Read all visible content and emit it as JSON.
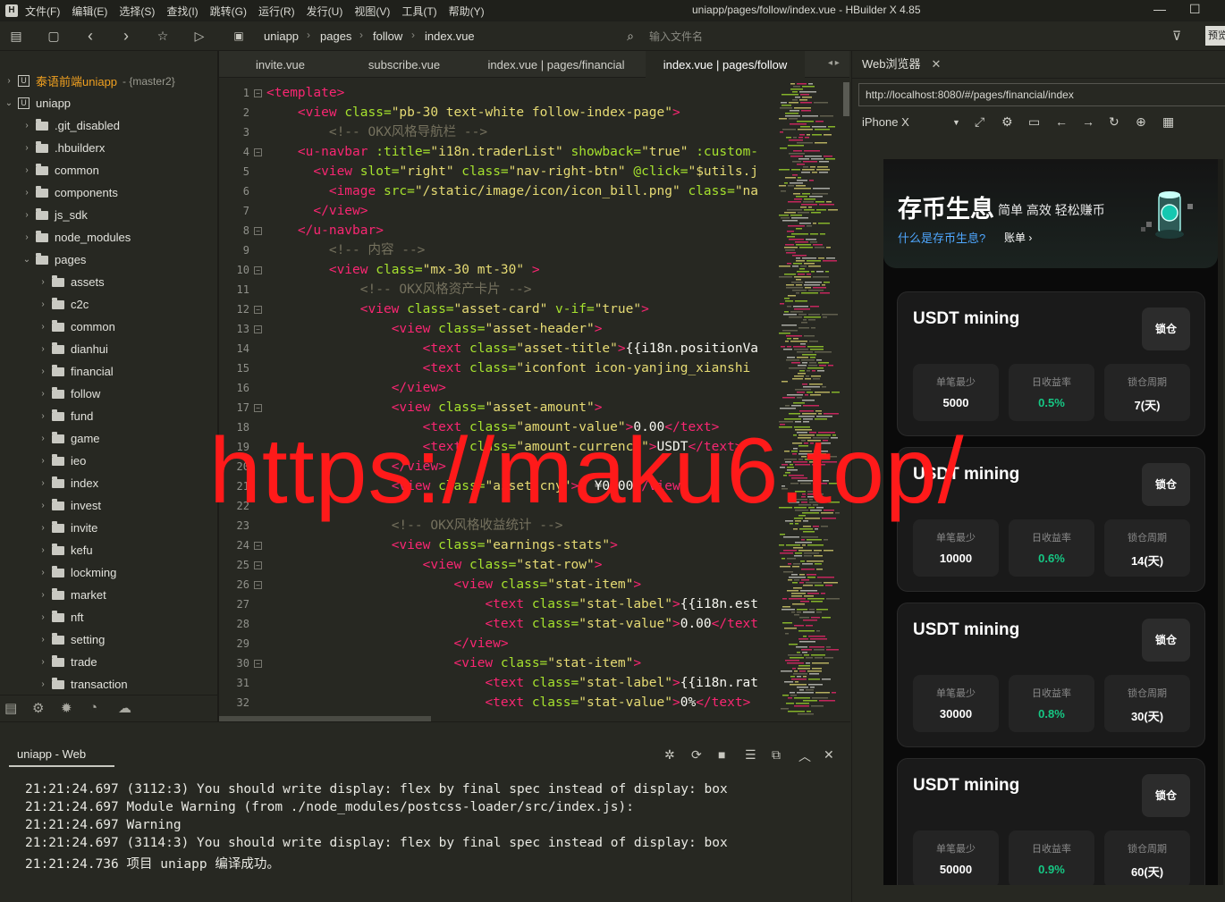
{
  "window": {
    "title": "uniapp/pages/follow/index.vue - HBuilder X 4.85",
    "menu": [
      "文件(F)",
      "编辑(E)",
      "选择(S)",
      "查找(I)",
      "跳转(G)",
      "运行(R)",
      "发行(U)",
      "视图(V)",
      "工具(T)",
      "帮助(Y)"
    ],
    "minimize": "—",
    "maximize": "☐"
  },
  "toolbar": {
    "breadcrumb": [
      "uniapp",
      "pages",
      "follow",
      "index.vue"
    ],
    "file_search_placeholder": "输入文件名",
    "preview_label": "预览"
  },
  "sidebar": {
    "items": [
      {
        "label": "泰语前端uniapp",
        "branch": "- {master2}",
        "level": 0,
        "expanded": false,
        "type": "project"
      },
      {
        "label": "uniapp",
        "level": 0,
        "expanded": true,
        "type": "project"
      },
      {
        "label": ".git_disabled",
        "level": 1,
        "expanded": false,
        "type": "folder"
      },
      {
        "label": ".hbuilderx",
        "level": 1,
        "expanded": false,
        "type": "folder"
      },
      {
        "label": "common",
        "level": 1,
        "expanded": false,
        "type": "folder"
      },
      {
        "label": "components",
        "level": 1,
        "expanded": false,
        "type": "folder"
      },
      {
        "label": "js_sdk",
        "level": 1,
        "expanded": false,
        "type": "folder"
      },
      {
        "label": "node_modules",
        "level": 1,
        "expanded": false,
        "type": "folder"
      },
      {
        "label": "pages",
        "level": 1,
        "expanded": true,
        "type": "folder"
      },
      {
        "label": "assets",
        "level": 2,
        "expanded": false,
        "type": "folder"
      },
      {
        "label": "c2c",
        "level": 2,
        "expanded": false,
        "type": "folder"
      },
      {
        "label": "common",
        "level": 2,
        "expanded": false,
        "type": "folder"
      },
      {
        "label": "dianhui",
        "level": 2,
        "expanded": false,
        "type": "folder"
      },
      {
        "label": "financial",
        "level": 2,
        "expanded": false,
        "type": "folder"
      },
      {
        "label": "follow",
        "level": 2,
        "expanded": false,
        "type": "folder"
      },
      {
        "label": "fund",
        "level": 2,
        "expanded": false,
        "type": "folder"
      },
      {
        "label": "game",
        "level": 2,
        "expanded": false,
        "type": "folder"
      },
      {
        "label": "ieo",
        "level": 2,
        "expanded": false,
        "type": "folder"
      },
      {
        "label": "index",
        "level": 2,
        "expanded": false,
        "type": "folder"
      },
      {
        "label": "invest",
        "level": 2,
        "expanded": false,
        "type": "folder"
      },
      {
        "label": "invite",
        "level": 2,
        "expanded": false,
        "type": "folder"
      },
      {
        "label": "kefu",
        "level": 2,
        "expanded": false,
        "type": "folder"
      },
      {
        "label": "lockming",
        "level": 2,
        "expanded": false,
        "type": "folder"
      },
      {
        "label": "market",
        "level": 2,
        "expanded": false,
        "type": "folder"
      },
      {
        "label": "nft",
        "level": 2,
        "expanded": false,
        "type": "folder"
      },
      {
        "label": "setting",
        "level": 2,
        "expanded": false,
        "type": "folder"
      },
      {
        "label": "trade",
        "level": 2,
        "expanded": false,
        "type": "folder"
      },
      {
        "label": "transaction",
        "level": 2,
        "expanded": false,
        "type": "folder"
      }
    ]
  },
  "editor": {
    "tabs": [
      {
        "label": "invite.vue",
        "active": false
      },
      {
        "label": "subscribe.vue",
        "active": false
      },
      {
        "label": "index.vue | pages/financial",
        "active": false
      },
      {
        "label": "index.vue | pages/follow",
        "active": true
      }
    ],
    "lines": [
      {
        "n": "1",
        "fold": true,
        "html": "<span class=\"tag\">&lt;template&gt;</span>"
      },
      {
        "n": "2",
        "fold": false,
        "html": "    <span class=\"tag\">&lt;view</span> <span class=\"attr\">class=</span><span class=\"str\">\"pb-30 text-white follow-index-page\"</span><span class=\"tag\">&gt;</span>"
      },
      {
        "n": "3",
        "fold": false,
        "html": "        <span class=\"cmt\">&lt;!-- OKX风格导航栏 --&gt;</span>"
      },
      {
        "n": "4",
        "fold": true,
        "html": "    <span class=\"tag\">&lt;u-navbar</span> <span class=\"attr\">:title=</span><span class=\"str\">\"i18n.traderList\"</span> <span class=\"attr\">showback=</span><span class=\"str\">\"true\"</span> <span class=\"attr\">:custom-</span>"
      },
      {
        "n": "5",
        "fold": false,
        "html": "      <span class=\"tag\">&lt;view</span> <span class=\"attr\">slot=</span><span class=\"str\">\"right\"</span> <span class=\"attr\">class=</span><span class=\"str\">\"nav-right-btn\"</span> <span class=\"attr\">@click=</span><span class=\"str\">\"$utils.j</span>"
      },
      {
        "n": "6",
        "fold": false,
        "html": "        <span class=\"tag\">&lt;image</span> <span class=\"attr\">src=</span><span class=\"str\">\"/static/image/icon/icon_bill.png\"</span> <span class=\"attr\">class=</span><span class=\"str\">\"na</span>"
      },
      {
        "n": "7",
        "fold": false,
        "html": "      <span class=\"tag\">&lt;/view&gt;</span>"
      },
      {
        "n": "8",
        "fold": true,
        "html": "    <span class=\"tag\">&lt;/u-navbar&gt;</span>"
      },
      {
        "n": "9",
        "fold": false,
        "html": "        <span class=\"cmt\">&lt;!-- 内容 --&gt;</span>"
      },
      {
        "n": "10",
        "fold": true,
        "html": "        <span class=\"tag\">&lt;view</span> <span class=\"attr\">class=</span><span class=\"str\">\"mx-30 mt-30\"</span> <span class=\"tag\">&gt;</span>"
      },
      {
        "n": "11",
        "fold": false,
        "html": "            <span class=\"cmt\">&lt;!-- OKX风格资产卡片 --&gt;</span>"
      },
      {
        "n": "12",
        "fold": true,
        "html": "            <span class=\"tag\">&lt;view</span> <span class=\"attr\">class=</span><span class=\"str\">\"asset-card\"</span> <span class=\"attr\">v-if=</span><span class=\"str\">\"true\"</span><span class=\"tag\">&gt;</span>"
      },
      {
        "n": "13",
        "fold": true,
        "html": "                <span class=\"tag\">&lt;view</span> <span class=\"attr\">class=</span><span class=\"str\">\"asset-header\"</span><span class=\"tag\">&gt;</span>"
      },
      {
        "n": "14",
        "fold": false,
        "html": "                    <span class=\"tag\">&lt;text</span> <span class=\"attr\">class=</span><span class=\"str\">\"asset-title\"</span><span class=\"tag\">&gt;</span><span class=\"txt\">{{i18n.positionVa</span>"
      },
      {
        "n": "15",
        "fold": false,
        "html": "                    <span class=\"tag\">&lt;text</span> <span class=\"attr\">class=</span><span class=\"str\">\"iconfont icon-yanjing_xianshi</span>"
      },
      {
        "n": "16",
        "fold": false,
        "html": "                <span class=\"tag\">&lt;/view&gt;</span>"
      },
      {
        "n": "17",
        "fold": true,
        "html": "                <span class=\"tag\">&lt;view</span> <span class=\"attr\">class=</span><span class=\"str\">\"asset-amount\"</span><span class=\"tag\">&gt;</span>"
      },
      {
        "n": "18",
        "fold": false,
        "html": "                    <span class=\"tag\">&lt;text</span> <span class=\"attr\">class=</span><span class=\"str\">\"amount-value\"</span><span class=\"tag\">&gt;</span><span class=\"txt\">0.00</span><span class=\"tag\">&lt;/text&gt;</span>"
      },
      {
        "n": "19",
        "fold": false,
        "html": "                    <span class=\"tag\">&lt;text</span> <span class=\"attr\">class=</span><span class=\"str\">\"amount-currency\"</span><span class=\"tag\">&gt;</span><span class=\"txt\">USDT</span><span class=\"tag\">&lt;/text&gt;</span>"
      },
      {
        "n": "20",
        "fold": false,
        "html": "                <span class=\"tag\">&lt;/view&gt;</span>"
      },
      {
        "n": "21",
        "fold": false,
        "html": "                <span class=\"tag\">&lt;view</span> <span class=\"attr\">class=</span><span class=\"str\">\"asset-cny\"</span><span class=\"tag\">&gt;</span><span class=\"txt\">≈ ¥0.00</span><span class=\"tag\">&lt;/view&gt;</span>"
      },
      {
        "n": "22",
        "fold": false,
        "html": ""
      },
      {
        "n": "23",
        "fold": false,
        "html": "                <span class=\"cmt\">&lt;!-- OKX风格收益统计 --&gt;</span>"
      },
      {
        "n": "24",
        "fold": true,
        "html": "                <span class=\"tag\">&lt;view</span> <span class=\"attr\">class=</span><span class=\"str\">\"earnings-stats\"</span><span class=\"tag\">&gt;</span>"
      },
      {
        "n": "25",
        "fold": true,
        "html": "                    <span class=\"tag\">&lt;view</span> <span class=\"attr\">class=</span><span class=\"str\">\"stat-row\"</span><span class=\"tag\">&gt;</span>"
      },
      {
        "n": "26",
        "fold": true,
        "html": "                        <span class=\"tag\">&lt;view</span> <span class=\"attr\">class=</span><span class=\"str\">\"stat-item\"</span><span class=\"tag\">&gt;</span>"
      },
      {
        "n": "27",
        "fold": false,
        "html": "                            <span class=\"tag\">&lt;text</span> <span class=\"attr\">class=</span><span class=\"str\">\"stat-label\"</span><span class=\"tag\">&gt;</span><span class=\"txt\">{{i18n.est</span>"
      },
      {
        "n": "28",
        "fold": false,
        "html": "                            <span class=\"tag\">&lt;text</span> <span class=\"attr\">class=</span><span class=\"str\">\"stat-value\"</span><span class=\"tag\">&gt;</span><span class=\"txt\">0.00</span><span class=\"tag\">&lt;/text</span>"
      },
      {
        "n": "29",
        "fold": false,
        "html": "                        <span class=\"tag\">&lt;/view&gt;</span>"
      },
      {
        "n": "30",
        "fold": true,
        "html": "                        <span class=\"tag\">&lt;view</span> <span class=\"attr\">class=</span><span class=\"str\">\"stat-item\"</span><span class=\"tag\">&gt;</span>"
      },
      {
        "n": "31",
        "fold": false,
        "html": "                            <span class=\"tag\">&lt;text</span> <span class=\"attr\">class=</span><span class=\"str\">\"stat-label\"</span><span class=\"tag\">&gt;</span><span class=\"txt\">{{i18n.rat</span>"
      },
      {
        "n": "32",
        "fold": false,
        "html": "                            <span class=\"tag\">&lt;text</span> <span class=\"attr\">class=</span><span class=\"str\">\"stat-value\"</span><span class=\"tag\">&gt;</span><span class=\"txt\">0%</span><span class=\"tag\">&lt;/text&gt;</span>"
      }
    ]
  },
  "console": {
    "tab_label": "uniapp - Web",
    "lines": [
      "21:21:24.697 (3112:3) You should write display: flex by final spec instead of display: box",
      "21:21:24.697 Module Warning (from ./node_modules/postcss-loader/src/index.js):",
      "21:21:24.697 Warning",
      "21:21:24.697 (3114:3) You should write display: flex by final spec instead of display: box",
      "21:21:24.736 项目 uniapp 编译成功。"
    ]
  },
  "browser": {
    "tab_label": "Web浏览器",
    "url": "http://localhost:8080/#/pages/financial/index",
    "device": "iPhone X",
    "page": {
      "hero_title": "存币生息",
      "hero_subtitle": "简单 高效 轻松赚币",
      "hero_link": "什么是存币生息?",
      "hero_link2": "账单 ›",
      "cards": [
        {
          "title": "USDT mining",
          "button": "锁仓",
          "min_label": "单笔最少",
          "min_value": "5000",
          "rate_label": "日收益率",
          "rate_value": "0.5%",
          "period_label": "锁仓周期",
          "period_value": "7(天)"
        },
        {
          "title": "USDT mining",
          "button": "锁仓",
          "min_label": "单笔最少",
          "min_value": "10000",
          "rate_label": "日收益率",
          "rate_value": "0.6%",
          "period_label": "锁仓周期",
          "period_value": "14(天)"
        },
        {
          "title": "USDT mining",
          "button": "锁仓",
          "min_label": "单笔最少",
          "min_value": "30000",
          "rate_label": "日收益率",
          "rate_value": "0.8%",
          "period_label": "锁仓周期",
          "period_value": "30(天)"
        },
        {
          "title": "USDT mining",
          "button": "锁仓",
          "min_label": "单笔最少",
          "min_value": "50000",
          "rate_label": "日收益率",
          "rate_value": "0.9%",
          "period_label": "锁仓周期",
          "period_value": "60(天)"
        }
      ]
    }
  },
  "watermark": "https://maku6.top/",
  "colors": {
    "accent_green": "#16c784",
    "link_blue": "#4fa7ff",
    "watermark_red": "#ff1a1a"
  }
}
